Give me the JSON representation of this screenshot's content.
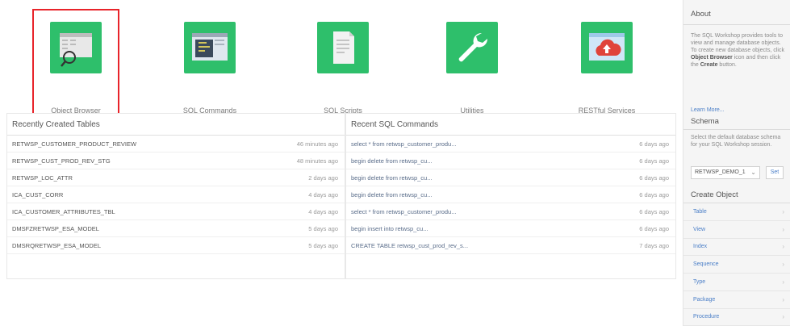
{
  "tiles": [
    {
      "label": "Object Browser",
      "icon": "object-browser-icon",
      "selected": true
    },
    {
      "label": "SQL Commands",
      "icon": "sql-commands-icon",
      "selected": false
    },
    {
      "label": "SQL Scripts",
      "icon": "sql-scripts-icon",
      "selected": false
    },
    {
      "label": "Utilities",
      "icon": "wrench-icon",
      "selected": false
    },
    {
      "label": "RESTful Services",
      "icon": "cloud-upload-icon",
      "selected": false
    }
  ],
  "recent_tables": {
    "title": "Recently Created Tables",
    "rows": [
      {
        "name": "RETWSP_CUSTOMER_PRODUCT_REVIEW",
        "time": "46 minutes ago"
      },
      {
        "name": "RETWSP_CUST_PROD_REV_STG",
        "time": "48 minutes ago"
      },
      {
        "name": "RETWSP_LOC_ATTR",
        "time": "2 days ago"
      },
      {
        "name": "ICA_CUST_CORR",
        "time": "4 days ago"
      },
      {
        "name": "ICA_CUSTOMER_ATTRIBUTES_TBL",
        "time": "4 days ago"
      },
      {
        "name": "DMSFZRETWSP_ESA_MODEL",
        "time": "5 days ago"
      },
      {
        "name": "DMSRQRETWSP_ESA_MODEL",
        "time": "5 days ago"
      }
    ]
  },
  "recent_sql": {
    "title": "Recent SQL Commands",
    "rows": [
      {
        "name": "select * from retwsp_customer_produ...",
        "time": "6 days ago"
      },
      {
        "name": "begin delete from retwsp_cu...",
        "time": "6 days ago"
      },
      {
        "name": "begin delete from retwsp_cu...",
        "time": "6 days ago"
      },
      {
        "name": "begin delete from retwsp_cu...",
        "time": "6 days ago"
      },
      {
        "name": "select * from retwsp_customer_produ...",
        "time": "6 days ago"
      },
      {
        "name": "begin insert into retwsp_cu...",
        "time": "6 days ago"
      },
      {
        "name": "CREATE TABLE retwsp_cust_prod_rev_s...",
        "time": "7 days ago"
      }
    ]
  },
  "sidebar": {
    "about_title": "About",
    "about_text_1": "The SQL Workshop provides tools to view and manage database objects. To create new database objects, click ",
    "about_bold_1": "Object Browser",
    "about_text_2": " icon and then click the ",
    "about_bold_2": "Create",
    "about_text_3": " button.",
    "learn_more": "Learn More...",
    "schema_title": "Schema",
    "schema_text": "Select the default database schema for your SQL Workshop session.",
    "schema_value": "RETWSP_DEMO_1",
    "set_label": "Set",
    "create_title": "Create Object",
    "create_items": [
      "Table",
      "View",
      "Index",
      "Sequence",
      "Type",
      "Package",
      "Procedure"
    ]
  },
  "colors": {
    "tile_green": "#2ebf6b",
    "selection_red": "#e8242a",
    "link_blue": "#4a7ec7"
  }
}
